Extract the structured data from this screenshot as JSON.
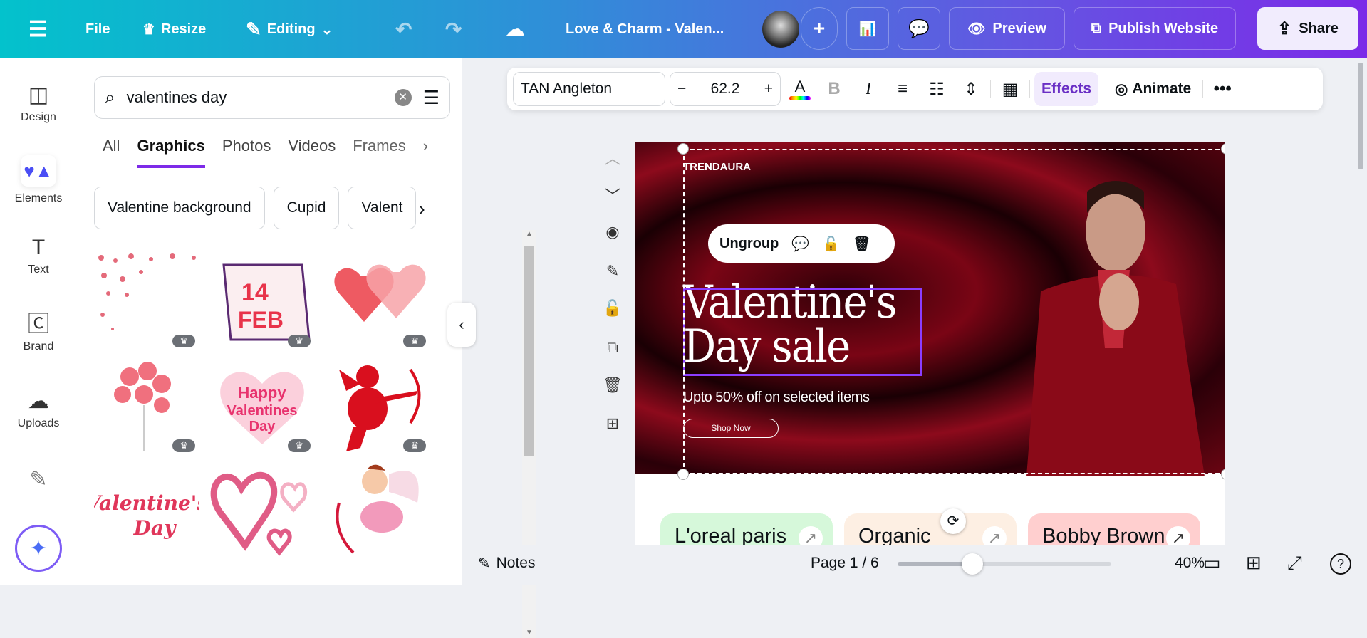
{
  "topbar": {
    "file": "File",
    "resize": "Resize",
    "editing": "Editing",
    "title": "Love & Charm - Valen...",
    "preview": "Preview",
    "publish": "Publish Website",
    "share": "Share"
  },
  "rail": [
    {
      "label": "Design",
      "icon": "layout-icon"
    },
    {
      "label": "Elements",
      "icon": "shapes-icon"
    },
    {
      "label": "Text",
      "icon": "text-icon"
    },
    {
      "label": "Brand",
      "icon": "brand-icon"
    },
    {
      "label": "Uploads",
      "icon": "cloud-upload-icon"
    }
  ],
  "panel": {
    "search_value": "valentines day",
    "tabs": [
      "All",
      "Graphics",
      "Photos",
      "Videos",
      "Frames"
    ],
    "active_tab": "Graphics",
    "chips": [
      "Valentine background",
      "Cupid",
      "Valent"
    ],
    "graphics": [
      {
        "kind": "hearts-corner",
        "premium": true
      },
      {
        "kind": "calendar",
        "text1": "14",
        "text2": "FEB",
        "premium": true
      },
      {
        "kind": "two-hearts",
        "premium": true
      },
      {
        "kind": "heart-balloons",
        "premium": true
      },
      {
        "kind": "happy-valentines",
        "text": "Happy Valentines Day",
        "premium": true
      },
      {
        "kind": "cupid-red",
        "premium": true
      },
      {
        "kind": "valentines-script",
        "text": "Valentine's Day",
        "premium": false
      },
      {
        "kind": "brush-hearts",
        "premium": false
      },
      {
        "kind": "cupid-cartoon",
        "premium": false
      }
    ]
  },
  "toolbar": {
    "font": "TAN Angleton",
    "size": "62.2",
    "effects": "Effects",
    "animate": "Animate",
    "accent": "#7d2ae8"
  },
  "design": {
    "brand": "TRENDAURA",
    "headline1": "Valentine's",
    "headline2": "Day sale",
    "subtitle": "Upto 50% off on selected items",
    "cta": "Shop Now",
    "context_menu": {
      "ungroup": "Ungroup"
    },
    "cards": [
      {
        "label": "L'oreal paris",
        "color": "#d6f8da"
      },
      {
        "label": "Organic",
        "color": "#fdefe3"
      },
      {
        "label": "Bobby Brown",
        "color": "#ffcfcf"
      }
    ]
  },
  "bottom": {
    "notes": "Notes",
    "page": "Page 1 / 6",
    "zoom": "40%",
    "zoom_fraction": 0.35
  }
}
